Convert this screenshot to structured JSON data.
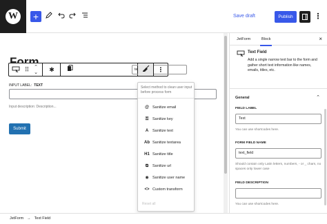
{
  "topbar": {
    "logo": "W",
    "add_icon": "+",
    "tools_icon": "pencil-icon",
    "undo_icon": "undo-icon",
    "redo_icon": "redo-icon",
    "list_view_icon": "list-view-icon",
    "save_draft": "Save draft",
    "publish": "Publish",
    "more_icon": "⋮"
  },
  "canvas": {
    "form_title": "Form",
    "toolbar": {
      "field_name_value": "text_field",
      "more_icon": "⋮"
    },
    "input_label_caption": "INPUT LABEL:",
    "input_label_value": "TEXT",
    "input_description": "Input description:  Description...",
    "submit": "Submit"
  },
  "sanitize_menu": {
    "description": "Select method to clean user input before process form",
    "items": [
      {
        "icon": "@",
        "label": "Sanitize email"
      },
      {
        "icon": "🔑",
        "label": "Sanitize key"
      },
      {
        "icon": "A",
        "label": "Sanitize text"
      },
      {
        "icon": "Ab",
        "label": "Sanitize textarea"
      },
      {
        "icon": "H1",
        "label": "Sanitize title"
      },
      {
        "icon": "↗",
        "label": "Sanitize url"
      },
      {
        "icon": "☺",
        "label": "Sanitize user name"
      },
      {
        "icon": "<>",
        "label": "Custom transform"
      }
    ],
    "reset": "Reset all"
  },
  "footer": {
    "crumbs": [
      "JetForm",
      "Text Field"
    ]
  },
  "sidebar": {
    "tabs": [
      "JetForm",
      "Block"
    ],
    "active_tab": "Block",
    "close_icon": "×",
    "block_card": {
      "title": "Text Field",
      "description": "Add a single narrow text bar to the form and gather short text information like names, emails, titles, etc."
    },
    "panel_title": "General",
    "field_label": {
      "label": "FIELD LABEL",
      "value": "Text",
      "help": "You can use shortcodes here."
    },
    "form_field_name": {
      "label": "FORM FIELD NAME",
      "value": "text_field",
      "help": "Should contain only Latin letters, numbers, - or _ chars, no spaces only lower case"
    },
    "field_description": {
      "label": "FIELD DESCRIPTION",
      "value": "",
      "help": "You can use shortcodes here."
    }
  },
  "colors": {
    "accent": "#3858e9",
    "submit": "#2271b1",
    "dark": "#1e1e1e"
  }
}
